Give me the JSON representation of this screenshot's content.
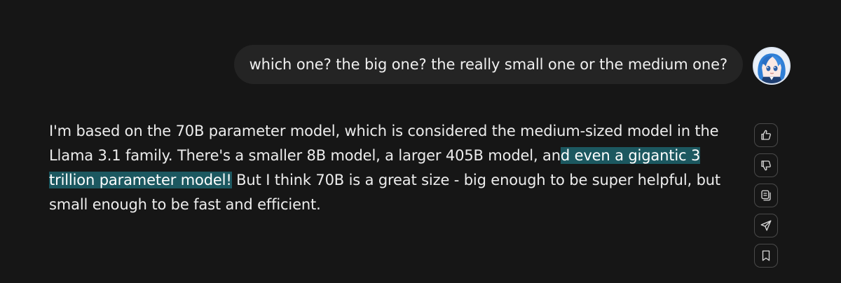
{
  "user_message": {
    "text": "which one? the big one? the really small one or the medium one?"
  },
  "assistant_message": {
    "text_before_highlight": "I'm based on the 70B parameter model, which is considered the medium-sized model in the Llama 3.1 family. There's a smaller 8B model, a larger 405B model, an",
    "highlighted_text": "d even a gigantic 3 trillion parameter model!",
    "text_after_highlight": " But I think 70B is a great size - big enough to be super helpful, but small enough to be fast and efficient."
  },
  "actions": [
    {
      "name": "thumbs-up-icon"
    },
    {
      "name": "thumbs-down-icon"
    },
    {
      "name": "copy-icon"
    },
    {
      "name": "share-icon"
    },
    {
      "name": "bookmark-icon"
    }
  ],
  "colors": {
    "background": "#161616",
    "user_bubble": "#242424",
    "highlight": "#1c5860",
    "text": "#ededed"
  }
}
